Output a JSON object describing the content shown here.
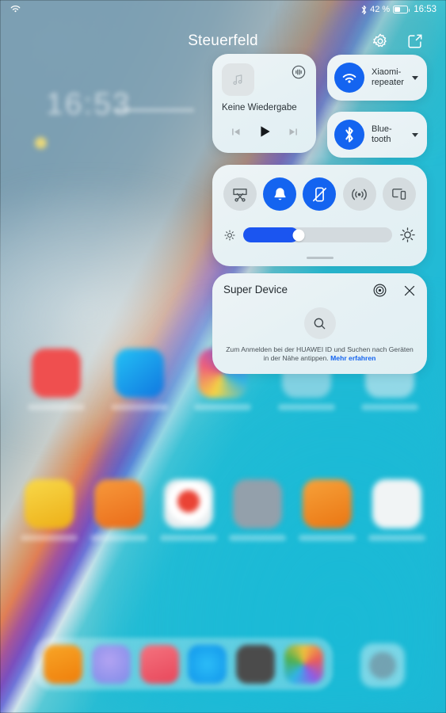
{
  "status_bar": {
    "wifi_icon": "wifi-icon",
    "bluetooth_icon": "bluetooth-icon",
    "battery_percent": "42 %",
    "battery_level": 42,
    "time": "16:53"
  },
  "header": {
    "title": "Steuerfeld",
    "settings_icon": "gear-icon",
    "edit_icon": "edit-icon"
  },
  "media_card": {
    "thumbnail_icon": "music-note-icon",
    "cast_icon": "audio-cast-icon",
    "title": "Keine Wiedergabe",
    "previous_icon": "previous-track-icon",
    "play_icon": "play-icon",
    "next_icon": "next-track-icon"
  },
  "connectivity": [
    {
      "name": "wifi-tile",
      "icon": "wifi-icon",
      "label": "Xiaomi-\nrepeater",
      "label_line1": "Xiaomi-",
      "label_line2": "repeater",
      "enabled": true,
      "accent": "#1464f0"
    },
    {
      "name": "bluetooth-tile",
      "icon": "bluetooth-icon",
      "label": "Blue-\ntooth",
      "label_line1": "Blue-",
      "label_line2": "tooth",
      "enabled": true,
      "accent": "#1464f0"
    }
  ],
  "toggles": [
    {
      "name": "screenshot-toggle",
      "icon": "screenshot-scissors-icon",
      "state": "off"
    },
    {
      "name": "sound-toggle",
      "icon": "bell-icon",
      "state": "on"
    },
    {
      "name": "auto-rotate-toggle",
      "icon": "rotation-lock-icon",
      "state": "on"
    },
    {
      "name": "hotspot-toggle",
      "icon": "hotspot-icon",
      "state": "off"
    },
    {
      "name": "multiscreen-toggle",
      "icon": "multi-screen-icon",
      "state": "off"
    }
  ],
  "brightness": {
    "name": "brightness-slider",
    "low_icon": "brightness-low-icon",
    "high_icon": "brightness-high-icon",
    "value": 37
  },
  "super_device": {
    "title": "Super Device",
    "target_icon": "super-device-target-icon",
    "close_icon": "close-icon",
    "search_icon": "search-icon",
    "description": "Zum Anmelden bei der HUAWEI ID und Suchen nach Geräten in der Nähe antippen.",
    "link_label": "Mehr erfahren"
  },
  "wallpaper": {
    "clock_widget": "16:53",
    "app_rows": [
      {
        "icons": [
          "#ef4f4f",
          "#1f9ff0",
          "#c9c2f2",
          "#2aa5d8",
          "#cfd8dc"
        ]
      },
      {
        "icons": [
          "#f2bf28",
          "#ee7a2b",
          "#e8eef0",
          "#8e99a3",
          "#ef8c22",
          "#f0f2f3"
        ]
      }
    ],
    "dock_icons": [
      "#f09213",
      "#9a8ce8",
      "#ef5f6e",
      "#22aef2",
      "#4a4a4a",
      "#e8eaec"
    ],
    "dock_extra_icon": "#8e98a3"
  },
  "colors": {
    "accent_blue": "#1464f0",
    "panel_bg": "#e6f1f4",
    "toggle_off": "#d5dcdf",
    "link_blue": "#1464f0"
  }
}
